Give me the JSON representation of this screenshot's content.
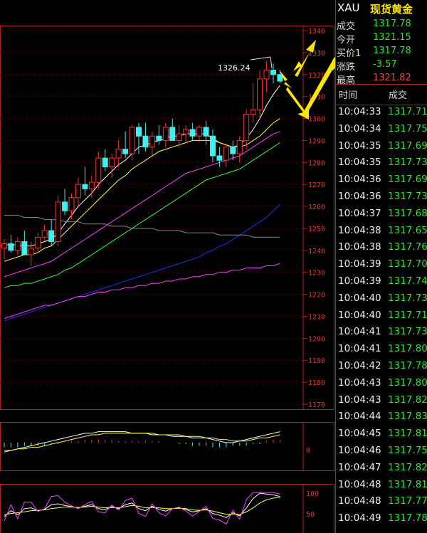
{
  "quote": {
    "symbol": "XAU",
    "name": "现货黄金",
    "fields": [
      {
        "label": "成交",
        "value": "1317.78",
        "color": "#2ee62e"
      },
      {
        "label": "今开",
        "value": "1321.15",
        "color": "#2ee62e"
      },
      {
        "label": "买价1",
        "value": "1317.78",
        "color": "#2ee62e"
      },
      {
        "label": "涨跌",
        "value": "-3.57",
        "color": "#2ee62e"
      },
      {
        "label": "最高",
        "value": "1321.82",
        "color": "#ff4040"
      }
    ]
  },
  "ticks": {
    "header_time": "时间",
    "header_price": "成交",
    "rows": [
      {
        "time": "10:04:33",
        "price": "1317.71"
      },
      {
        "time": "10:04:34",
        "price": "1317.75"
      },
      {
        "time": "10:04:35",
        "price": "1317.69"
      },
      {
        "time": "10:04:35",
        "price": "1317.73"
      },
      {
        "time": "10:04:36",
        "price": "1317.69"
      },
      {
        "time": "10:04:36",
        "price": "1317.73"
      },
      {
        "time": "10:04:37",
        "price": "1317.68"
      },
      {
        "time": "10:04:38",
        "price": "1317.65"
      },
      {
        "time": "10:04:38",
        "price": "1317.76"
      },
      {
        "time": "10:04:39",
        "price": "1317.70"
      },
      {
        "time": "10:04:39",
        "price": "1317.74"
      },
      {
        "time": "10:04:40",
        "price": "1317.73"
      },
      {
        "time": "10:04:40",
        "price": "1317.71"
      },
      {
        "time": "10:04:41",
        "price": "1317.73"
      },
      {
        "time": "10:04:41",
        "price": "1317.80"
      },
      {
        "time": "10:04:42",
        "price": "1317.78"
      },
      {
        "time": "10:04:43",
        "price": "1317.80"
      },
      {
        "time": "10:04:43",
        "price": "1317.82"
      },
      {
        "time": "10:04:44",
        "price": "1317.83"
      },
      {
        "time": "10:04:45",
        "price": "1317.81"
      },
      {
        "time": "10:04:46",
        "price": "1317.75"
      },
      {
        "time": "10:04:47",
        "price": "1317.82"
      },
      {
        "time": "10:04:48",
        "price": "1317.81"
      },
      {
        "time": "10:04:48",
        "price": "1317.77"
      },
      {
        "time": "10:04:49",
        "price": "1317.78"
      }
    ]
  },
  "chart": {
    "high_label": "1326.24",
    "price_axis": [
      "1340",
      "1330",
      "1320",
      "1310",
      "1300",
      "1290",
      "1280",
      "1270",
      "1260",
      "1250",
      "1240",
      "1230",
      "1220",
      "1210",
      "1200",
      "1190",
      "1180",
      "1170"
    ],
    "macd_axis": [
      "0"
    ],
    "kdj_axis": [
      "100",
      "50"
    ],
    "candles": [
      [
        1241,
        1245,
        1236,
        1243
      ],
      [
        1243,
        1247,
        1239,
        1240
      ],
      [
        1240,
        1246,
        1238,
        1244
      ],
      [
        1244,
        1249,
        1240,
        1238
      ],
      [
        1238,
        1244,
        1233,
        1241
      ],
      [
        1241,
        1248,
        1239,
        1246
      ],
      [
        1246,
        1252,
        1244,
        1249
      ],
      [
        1249,
        1254,
        1242,
        1244
      ],
      [
        1244,
        1265,
        1242,
        1262
      ],
      [
        1262,
        1268,
        1256,
        1258
      ],
      [
        1258,
        1266,
        1254,
        1264
      ],
      [
        1264,
        1273,
        1260,
        1270
      ],
      [
        1270,
        1278,
        1265,
        1268
      ],
      [
        1268,
        1274,
        1264,
        1271
      ],
      [
        1271,
        1285,
        1268,
        1282
      ],
      [
        1282,
        1286,
        1276,
        1278
      ],
      [
        1278,
        1284,
        1273,
        1282
      ],
      [
        1282,
        1290,
        1278,
        1286
      ],
      [
        1286,
        1294,
        1282,
        1284
      ],
      [
        1284,
        1297,
        1281,
        1296
      ],
      [
        1296,
        1298,
        1284,
        1292
      ],
      [
        1292,
        1298,
        1285,
        1287
      ],
      [
        1287,
        1294,
        1283,
        1292
      ],
      [
        1292,
        1297,
        1288,
        1290
      ],
      [
        1290,
        1298,
        1287,
        1296
      ],
      [
        1296,
        1300,
        1290,
        1290
      ],
      [
        1290,
        1297,
        1287,
        1293
      ],
      [
        1293,
        1297,
        1289,
        1295
      ],
      [
        1295,
        1298,
        1290,
        1292
      ],
      [
        1292,
        1297,
        1289,
        1296
      ],
      [
        1296,
        1299,
        1288,
        1292
      ],
      [
        1292,
        1295,
        1280,
        1283
      ],
      [
        1283,
        1287,
        1278,
        1281
      ],
      [
        1281,
        1285,
        1278,
        1287
      ],
      [
        1287,
        1290,
        1281,
        1284
      ],
      [
        1284,
        1292,
        1280,
        1290
      ],
      [
        1290,
        1304,
        1286,
        1302
      ],
      [
        1302,
        1316,
        1298,
        1304
      ],
      [
        1304,
        1322,
        1300,
        1318
      ],
      [
        1318,
        1326,
        1312,
        1322
      ],
      [
        1322,
        1325,
        1316,
        1320
      ],
      [
        1320,
        1322,
        1316,
        1317
      ]
    ],
    "ma": [
      {
        "color": "#ffffff",
        "values": [
          1242,
          1243,
          1242,
          1242,
          1242,
          1243,
          1244,
          1245,
          1248,
          1252,
          1256,
          1260,
          1263,
          1266,
          1270,
          1273,
          1276,
          1279,
          1281,
          1284,
          1287,
          1288,
          1289,
          1290,
          1291,
          1292,
          1292,
          1293,
          1293,
          1293,
          1293,
          1291,
          1289,
          1288,
          1287,
          1288,
          1291,
          1295,
          1300,
          1306,
          1311,
          1315
        ]
      },
      {
        "color": "#ffff40",
        "values": [
          1235,
          1236,
          1237,
          1238,
          1238,
          1239,
          1241,
          1242,
          1245,
          1248,
          1251,
          1254,
          1257,
          1260,
          1263,
          1266,
          1269,
          1272,
          1274,
          1277,
          1279,
          1281,
          1283,
          1285,
          1286,
          1287,
          1288,
          1289,
          1290,
          1290,
          1290,
          1290,
          1289,
          1288,
          1287,
          1287,
          1288,
          1290,
          1292,
          1295,
          1298,
          1300
        ]
      },
      {
        "color": "#ff40ff",
        "values": [
          1228,
          1229,
          1230,
          1231,
          1232,
          1233,
          1234,
          1235,
          1237,
          1239,
          1241,
          1243,
          1245,
          1247,
          1249,
          1251,
          1253,
          1255,
          1257,
          1259,
          1261,
          1263,
          1265,
          1267,
          1269,
          1271,
          1273,
          1275,
          1276,
          1277,
          1278,
          1279,
          1280,
          1281,
          1282,
          1283,
          1285,
          1287,
          1289,
          1291,
          1293,
          1294
        ]
      },
      {
        "color": "#33ff33",
        "values": [
          1223,
          1224,
          1224,
          1225,
          1225,
          1226,
          1227,
          1228,
          1229,
          1231,
          1232,
          1234,
          1236,
          1238,
          1240,
          1242,
          1244,
          1246,
          1248,
          1250,
          1252,
          1254,
          1256,
          1258,
          1260,
          1262,
          1264,
          1266,
          1268,
          1270,
          1272,
          1273,
          1274,
          1275,
          1276,
          1277,
          1279,
          1281,
          1283,
          1285,
          1287,
          1289
        ]
      },
      {
        "color": "#2030ff",
        "values": [
          1208,
          1209,
          1210,
          1211,
          1212,
          1213,
          1214,
          1215,
          1216,
          1217,
          1218,
          1219,
          1220,
          1221,
          1222,
          1223,
          1224,
          1225,
          1226,
          1227,
          1228,
          1229,
          1230,
          1231,
          1232,
          1233,
          1234,
          1235,
          1236,
          1237,
          1239,
          1240,
          1242,
          1243,
          1245,
          1247,
          1249,
          1251,
          1253,
          1255,
          1258,
          1261
        ]
      },
      {
        "color": "#888888",
        "values": [
          1256,
          1256,
          1256,
          1255,
          1255,
          1255,
          1254,
          1254,
          1254,
          1253,
          1253,
          1253,
          1252,
          1252,
          1252,
          1252,
          1251,
          1251,
          1251,
          1250,
          1250,
          1250,
          1250,
          1249,
          1249,
          1249,
          1249,
          1248,
          1248,
          1248,
          1248,
          1248,
          1247,
          1247,
          1247,
          1247,
          1247,
          1246,
          1246,
          1246,
          1246,
          1246
        ]
      },
      {
        "color": "#ff40ff",
        "values": [
          1209,
          1210,
          1211,
          1212,
          1213,
          1214,
          1215,
          1215,
          1216,
          1217,
          1218,
          1219,
          1219,
          1220,
          1221,
          1221,
          1222,
          1222,
          1223,
          1223,
          1224,
          1224,
          1225,
          1225,
          1226,
          1226,
          1227,
          1227,
          1228,
          1228,
          1229,
          1229,
          1230,
          1230,
          1231,
          1231,
          1232,
          1232,
          1232,
          1233,
          1233,
          1234
        ]
      }
    ],
    "macd_hist": [
      -3,
      -3,
      -3,
      -2,
      -2,
      -2,
      -2,
      -1,
      -1,
      1,
      1,
      1,
      2,
      2,
      2,
      2,
      2,
      1,
      1,
      1,
      1,
      1,
      1,
      1,
      0,
      0,
      -1,
      -1,
      -2,
      -2,
      -2,
      -3,
      -3,
      -3,
      -2,
      -2,
      -2,
      -1,
      -1,
      1,
      2,
      2
    ],
    "macd_dif": [
      -6,
      -5,
      -4,
      -3,
      -2,
      -1,
      0,
      1,
      2,
      3,
      4,
      5,
      6,
      6,
      7,
      7,
      7,
      7,
      7,
      6,
      6,
      6,
      5,
      5,
      5,
      4,
      4,
      4,
      3,
      3,
      3,
      2,
      1,
      0,
      0,
      1,
      2,
      3,
      4,
      5,
      6,
      7
    ],
    "macd_dea": [
      -5,
      -5,
      -4,
      -4,
      -3,
      -3,
      -2,
      -1,
      0,
      1,
      2,
      3,
      4,
      5,
      5,
      6,
      6,
      6,
      6,
      6,
      6,
      6,
      6,
      5,
      5,
      5,
      5,
      4,
      4,
      4,
      3,
      3,
      2,
      2,
      1,
      1,
      1,
      2,
      3,
      3,
      4,
      5
    ],
    "kdj_k": [
      40,
      55,
      45,
      60,
      62,
      55,
      58,
      70,
      72,
      68,
      65,
      62,
      66,
      70,
      60,
      58,
      65,
      60,
      70,
      74,
      60,
      55,
      66,
      58,
      54,
      60,
      62,
      58,
      52,
      55,
      60,
      48,
      44,
      38,
      50,
      42,
      62,
      85,
      98,
      96,
      94,
      90
    ],
    "kdj_d": [
      45,
      48,
      50,
      52,
      55,
      56,
      57,
      60,
      62,
      64,
      64,
      63,
      64,
      66,
      64,
      62,
      63,
      62,
      65,
      68,
      66,
      62,
      63,
      62,
      60,
      60,
      61,
      60,
      57,
      56,
      57,
      54,
      50,
      46,
      47,
      46,
      52,
      62,
      74,
      82,
      86,
      88
    ],
    "kdj_j": [
      30,
      70,
      35,
      76,
      76,
      53,
      60,
      90,
      92,
      76,
      67,
      60,
      70,
      78,
      52,
      50,
      69,
      56,
      80,
      86,
      48,
      41,
      72,
      50,
      42,
      60,
      64,
      54,
      42,
      53,
      66,
      36,
      32,
      22,
      56,
      34,
      82,
      100,
      100,
      100,
      100,
      96
    ]
  }
}
